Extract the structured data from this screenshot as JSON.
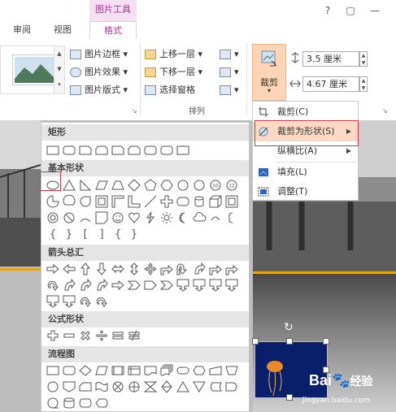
{
  "title_bar": {
    "context_tab": "图片工具",
    "help": "?",
    "restore": "▢",
    "minimize": "—"
  },
  "tabs": [
    {
      "label": "审阅"
    },
    {
      "label": "视图"
    },
    {
      "label": "格式"
    }
  ],
  "ribbon": {
    "picture_styles": {
      "border": "图片边框",
      "effects": "图片效果",
      "layout": "图片版式"
    },
    "arrange": {
      "bring_forward": "上移一层",
      "send_backward": "下移一层",
      "selection_pane": "选择窗格",
      "group_label": "排列"
    },
    "size": {
      "crop_label": "裁剪",
      "height_value": "3.5 厘米",
      "width_value": "4.67 厘米"
    }
  },
  "crop_menu": {
    "items": [
      {
        "label": "裁剪(C)"
      },
      {
        "label": "裁剪为形状(S)"
      },
      {
        "label": "纵横比(A)"
      },
      {
        "label": "填充(L)"
      },
      {
        "label": "调整(T)"
      }
    ]
  },
  "shape_menu": {
    "sections": [
      {
        "title": "矩形"
      },
      {
        "title": "基本形状"
      },
      {
        "title": "箭头总汇"
      },
      {
        "title": "公式形状"
      },
      {
        "title": "流程图"
      }
    ],
    "brace_row": [
      "{",
      "}",
      "[",
      "]",
      "{",
      "}"
    ],
    "number_shapes": [
      "10",
      "12"
    ]
  },
  "watermark": {
    "brand": "Bai",
    "sub": "经验",
    "url": "jingyan.baidu.com"
  },
  "colors": {
    "accent": "#a4378f",
    "highlight": "#e0323e",
    "ribbon_active": "#fbd5b5"
  }
}
